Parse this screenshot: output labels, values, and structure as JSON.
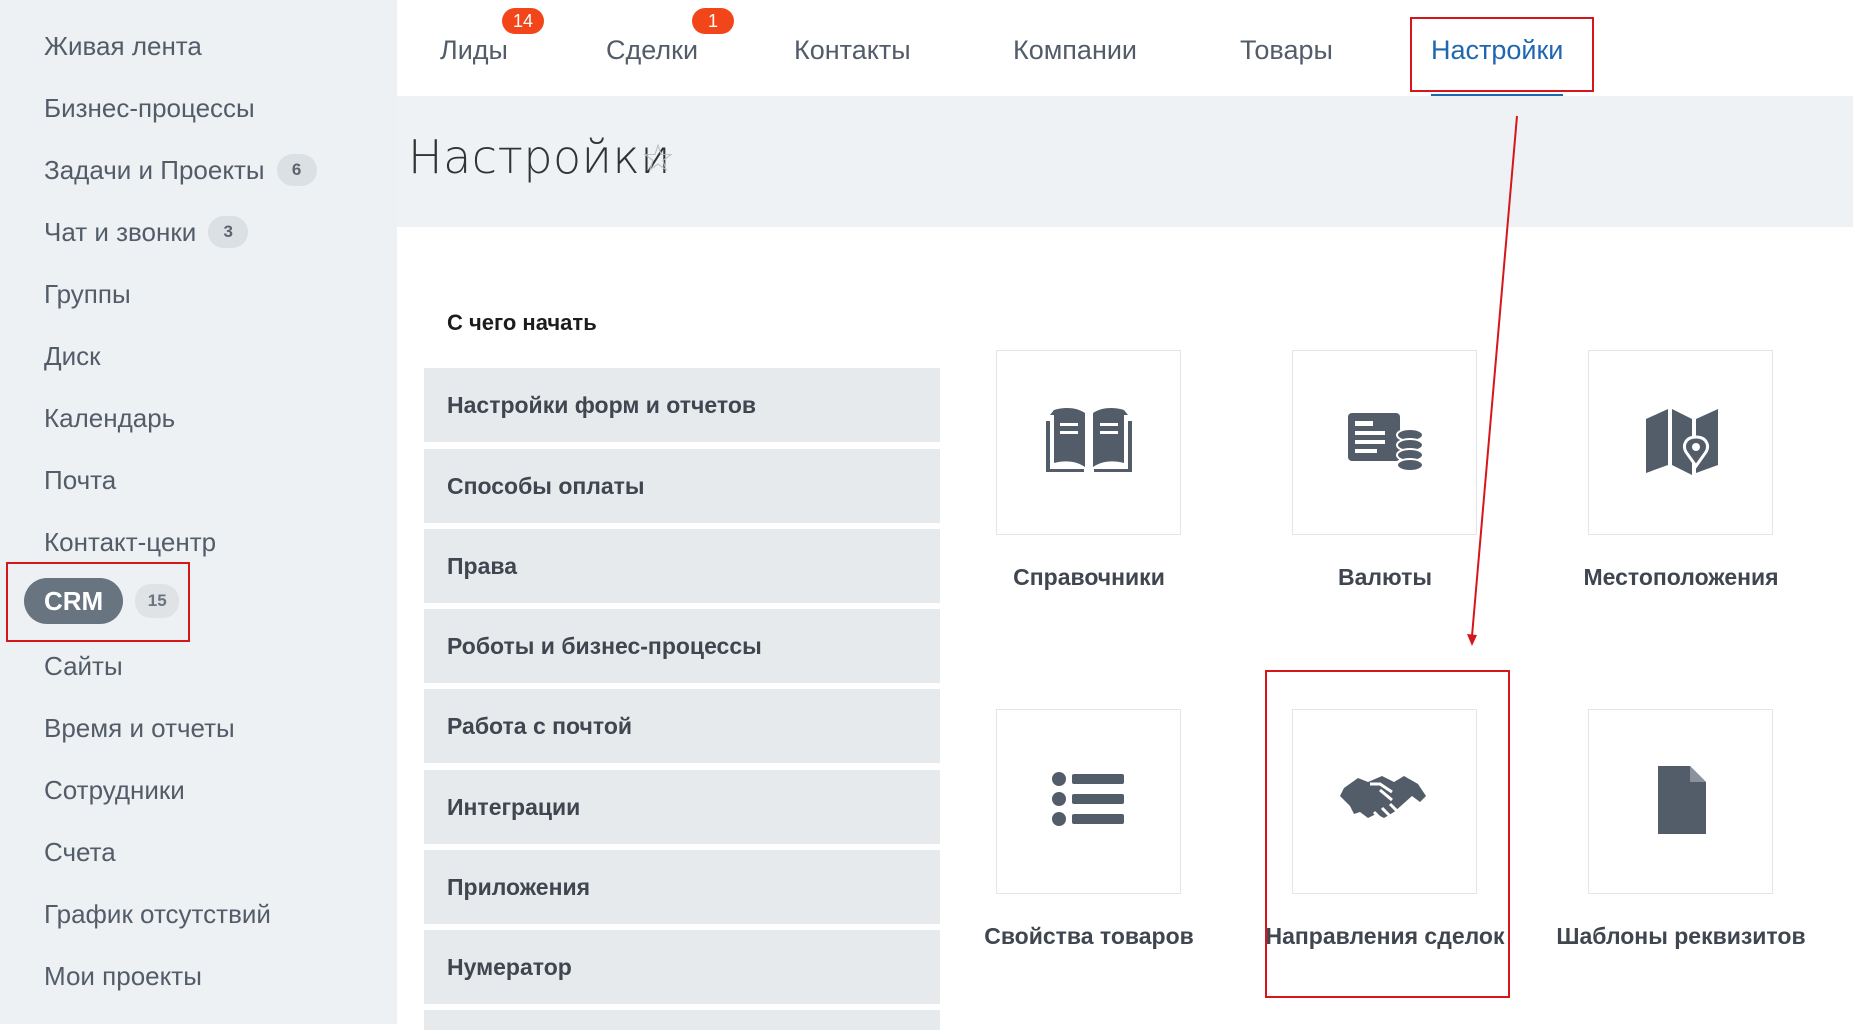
{
  "sidebar": {
    "items": [
      {
        "label": "Живая лента"
      },
      {
        "label": "Бизнес-процессы"
      },
      {
        "label": "Задачи и Проекты",
        "badge": "6"
      },
      {
        "label": "Чат и звонки",
        "badge": "3"
      },
      {
        "label": "Группы"
      },
      {
        "label": "Диск"
      },
      {
        "label": "Календарь"
      },
      {
        "label": "Почта"
      },
      {
        "label": "Контакт-центр"
      },
      {
        "label": "CRM",
        "badge": "15",
        "active": true
      },
      {
        "label": "Сайты"
      },
      {
        "label": "Время и отчеты"
      },
      {
        "label": "Сотрудники"
      },
      {
        "label": "Счета"
      },
      {
        "label": "График отсутствий"
      },
      {
        "label": "Мои проекты"
      }
    ]
  },
  "tabs": [
    {
      "label": "Лиды",
      "counter": "14"
    },
    {
      "label": "Сделки",
      "counter": "1"
    },
    {
      "label": "Контакты"
    },
    {
      "label": "Компании"
    },
    {
      "label": "Товары"
    },
    {
      "label": "Настройки",
      "active": true
    }
  ],
  "page": {
    "title": "Настройки",
    "star": "☆"
  },
  "settings": {
    "heading": "С чего начать",
    "menu": [
      "Настройки форм и отчетов",
      "Способы оплаты",
      "Права",
      "Роботы и бизнес-процессы",
      "Работа с почтой",
      "Интеграции",
      "Приложения",
      "Нумератор"
    ],
    "tiles": [
      {
        "label": "Справочники",
        "icon": "book-icon"
      },
      {
        "label": "Валюты",
        "icon": "currency-icon"
      },
      {
        "label": "Местоположения",
        "icon": "map-pin-icon"
      },
      {
        "label": "Свойства товаров",
        "icon": "list-icon"
      },
      {
        "label": "Направления сделок",
        "icon": "handshake-icon"
      },
      {
        "label": "Шаблоны реквизитов",
        "icon": "document-icon"
      }
    ]
  },
  "colors": {
    "accent": "#2067b0",
    "counter": "#f2461a",
    "highlight": "#d5161b",
    "icon": "#535c69"
  }
}
